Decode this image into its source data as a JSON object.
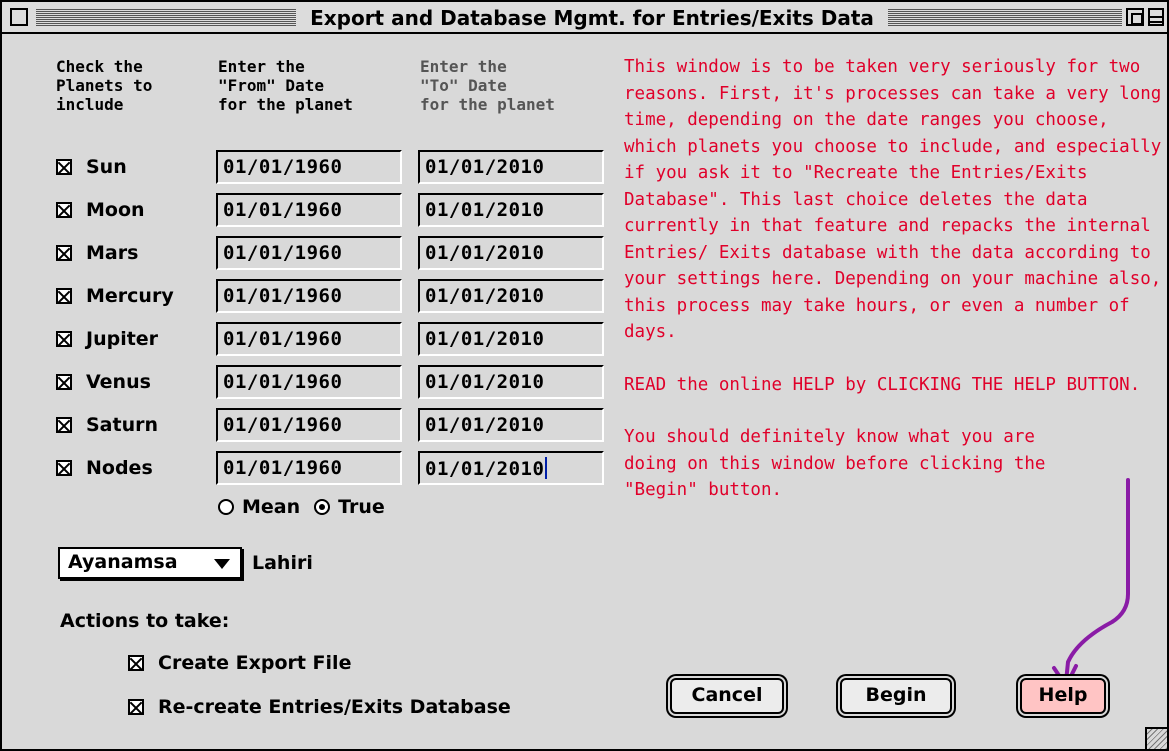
{
  "window": {
    "title": "Export and Database Mgmt. for Entries/Exits Data"
  },
  "headers": {
    "check": "Check the\nPlanets to\ninclude",
    "from": "Enter the\n\"From\" Date\nfor the planet",
    "to": "Enter the\n\"To\" Date\nfor the planet"
  },
  "planets": [
    {
      "name": "Sun",
      "checked": true,
      "from": "01/01/1960",
      "to": "01/01/2010"
    },
    {
      "name": "Moon",
      "checked": true,
      "from": "01/01/1960",
      "to": "01/01/2010"
    },
    {
      "name": "Mars",
      "checked": true,
      "from": "01/01/1960",
      "to": "01/01/2010"
    },
    {
      "name": "Mercury",
      "checked": true,
      "from": "01/01/1960",
      "to": "01/01/2010"
    },
    {
      "name": "Jupiter",
      "checked": true,
      "from": "01/01/1960",
      "to": "01/01/2010"
    },
    {
      "name": "Venus",
      "checked": true,
      "from": "01/01/1960",
      "to": "01/01/2010"
    },
    {
      "name": "Saturn",
      "checked": true,
      "from": "01/01/1960",
      "to": "01/01/2010"
    },
    {
      "name": "Nodes",
      "checked": true,
      "from": "01/01/1960",
      "to": "01/01/2010"
    }
  ],
  "nodes_mode": {
    "mean_label": "Mean",
    "true_label": "True",
    "selected": "True"
  },
  "ayanamsa": {
    "label": "Ayanamsa",
    "value": "Lahiri"
  },
  "actions": {
    "label": "Actions to take:",
    "create_export": {
      "label": "Create Export File",
      "checked": true
    },
    "recreate_db": {
      "label": "Re-create Entries/Exits Database",
      "checked": true
    }
  },
  "note": {
    "p1": "This window is to be taken very seriously for two reasons. First, it's processes can take a very long time, depending on the date ranges you choose, which planets you choose to include, and especially if you ask it to \"Recreate the Entries/Exits Database\". This last choice deletes the data currently in that feature and repacks the internal Entries/ Exits database with the data according to your settings here. Depending on your machine also, this process may take hours, or even a number of days.",
    "p2": "READ the online HELP by CLICKING THE HELP BUTTON.",
    "p3": "You should definitely know what you are doing on this window before clicking the \"Begin\" button."
  },
  "buttons": {
    "cancel": "Cancel",
    "begin": "Begin",
    "help": "Help"
  },
  "colors": {
    "note_text": "#e0002a",
    "arrow": "#8a1ca6",
    "help_button": "#ffc4c4",
    "window_bg": "#d9d9d9"
  }
}
